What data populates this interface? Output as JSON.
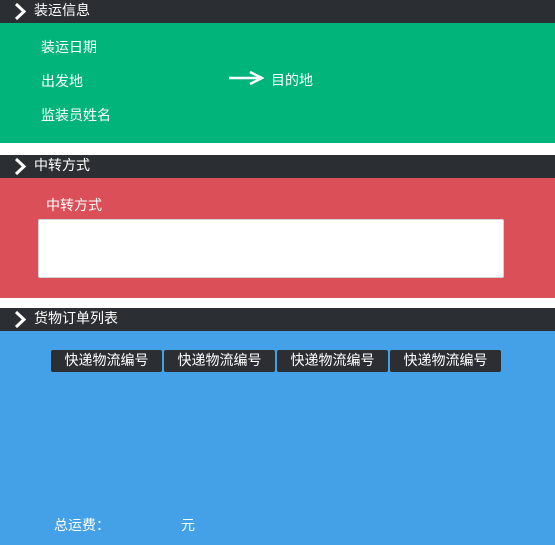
{
  "sections": {
    "shipping": {
      "title": "装运信息",
      "date_label": "装运日期",
      "origin_label": "出发地",
      "destination_label": "目的地",
      "supervisor_label": "监装员姓名"
    },
    "transfer": {
      "title": "中转方式",
      "field_label": "中转方式",
      "field_value": ""
    },
    "orders": {
      "title": "货物订单列表",
      "buttons": [
        "快递物流编号",
        "快递物流编号",
        "快递物流编号",
        "快递物流编号"
      ],
      "total_label": "总运费：",
      "total_value": "",
      "currency": "元"
    }
  },
  "colors": {
    "header_bg": "#2b2e33",
    "shipping_bg": "#00b47a",
    "transfer_bg": "#da4f58",
    "orders_bg": "#44a1e8"
  },
  "icons": {
    "section_header": "chevron-right-icon",
    "route": "arrow-right-icon"
  }
}
